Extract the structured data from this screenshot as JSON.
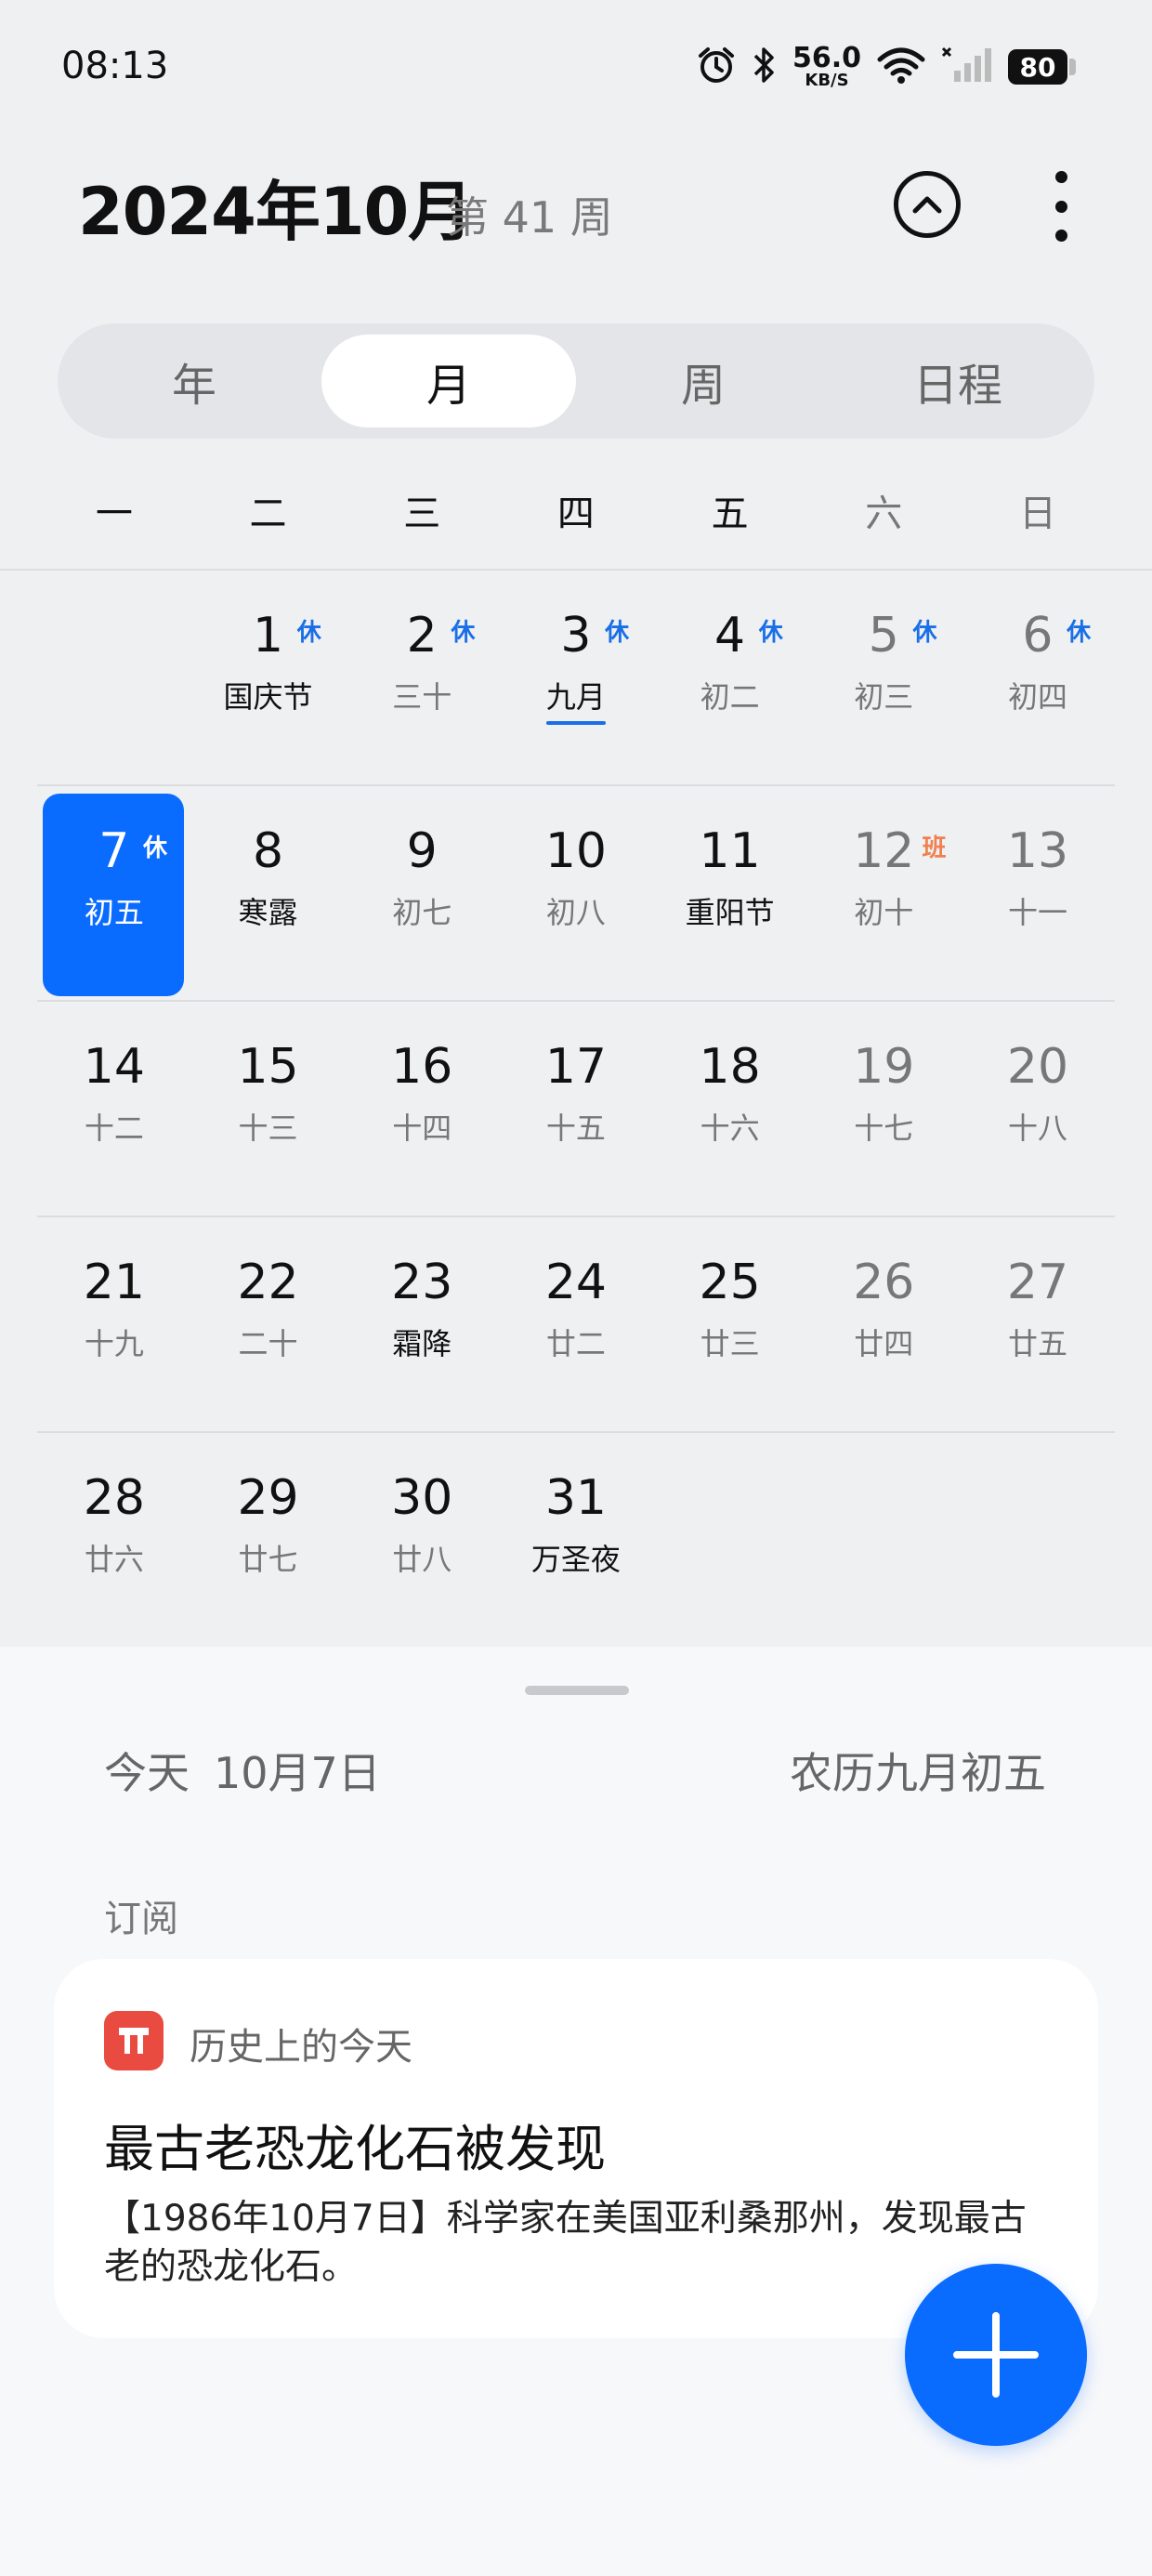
{
  "status_bar": {
    "time": "08:13",
    "net_speed_value": "56.0",
    "net_speed_unit": "KB/S",
    "battery": "80",
    "icons": [
      "alarm-icon",
      "bluetooth-icon",
      "wifi-icon",
      "signal-icon",
      "battery-icon"
    ]
  },
  "header": {
    "title": "2024年10月",
    "week": "第 41 周"
  },
  "tabs": [
    {
      "label": "年",
      "active": false
    },
    {
      "label": "月",
      "active": true
    },
    {
      "label": "周",
      "active": false
    },
    {
      "label": "日程",
      "active": false
    }
  ],
  "weekdays": [
    "一",
    "二",
    "三",
    "四",
    "五",
    "六",
    "日"
  ],
  "weeks": [
    [
      null,
      {
        "day": "1",
        "sub": "国庆节",
        "festival": true,
        "badge": "休"
      },
      {
        "day": "2",
        "sub": "三十",
        "badge": "休"
      },
      {
        "day": "3",
        "sub": "九月",
        "badge": "休",
        "underline": true,
        "festival": true
      },
      {
        "day": "4",
        "sub": "初二",
        "badge": "休"
      },
      {
        "day": "5",
        "sub": "初三",
        "badge": "休"
      },
      {
        "day": "6",
        "sub": "初四",
        "badge": "休"
      }
    ],
    [
      {
        "day": "7",
        "sub": "初五",
        "badge": "休",
        "today": true
      },
      {
        "day": "8",
        "sub": "寒露",
        "festival": true
      },
      {
        "day": "9",
        "sub": "初七"
      },
      {
        "day": "10",
        "sub": "初八"
      },
      {
        "day": "11",
        "sub": "重阳节",
        "festival": true
      },
      {
        "day": "12",
        "sub": "初十",
        "badge": "班",
        "badge_type": "work"
      },
      {
        "day": "13",
        "sub": "十一"
      }
    ],
    [
      {
        "day": "14",
        "sub": "十二"
      },
      {
        "day": "15",
        "sub": "十三"
      },
      {
        "day": "16",
        "sub": "十四"
      },
      {
        "day": "17",
        "sub": "十五"
      },
      {
        "day": "18",
        "sub": "十六"
      },
      {
        "day": "19",
        "sub": "十七"
      },
      {
        "day": "20",
        "sub": "十八"
      }
    ],
    [
      {
        "day": "21",
        "sub": "十九"
      },
      {
        "day": "22",
        "sub": "二十"
      },
      {
        "day": "23",
        "sub": "霜降",
        "festival": true
      },
      {
        "day": "24",
        "sub": "廿二"
      },
      {
        "day": "25",
        "sub": "廿三"
      },
      {
        "day": "26",
        "sub": "廿四"
      },
      {
        "day": "27",
        "sub": "廿五"
      }
    ],
    [
      {
        "day": "28",
        "sub": "廿六"
      },
      {
        "day": "29",
        "sub": "廿七"
      },
      {
        "day": "30",
        "sub": "廿八"
      },
      {
        "day": "31",
        "sub": "万圣夜",
        "festival": true
      },
      null,
      null,
      null
    ]
  ],
  "today_panel": {
    "today_label": "今天",
    "today_date": "10月7日",
    "lunar": "农历九月初五",
    "section": "订阅"
  },
  "card": {
    "app_name": "历史上的今天",
    "title": "最古老恐龙化石被发现",
    "body": "【1986年10月7日】科学家在美国亚利桑那州，发现最古老的恐龙化石。"
  },
  "colors": {
    "accent": "#0a6bff",
    "rest_badge": "#1a6fe6",
    "work_badge": "#f08050",
    "card_icon": "#e94b40"
  }
}
